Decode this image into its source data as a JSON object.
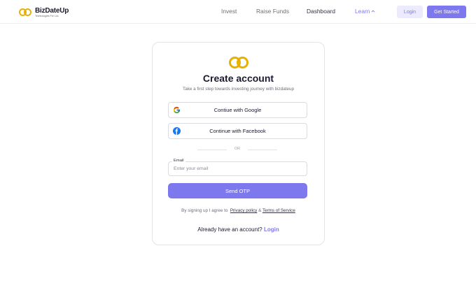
{
  "nav": {
    "logo_name": "BizDateUp",
    "logo_sub": "Technologies Pvt. Ltd.",
    "links": [
      "Invest",
      "Raise Funds",
      "Dashboard",
      "Learn"
    ],
    "login_label": "Login",
    "get_started_label": "Get Started"
  },
  "card": {
    "title": "Create account",
    "subtitle": "Take a first step towards investing journey with bizdateup",
    "google_label": "Contiue with Google",
    "facebook_label": "Continue with Facebook",
    "divider_text": "OR",
    "email_label": "Email",
    "email_placeholder": "Enter your email",
    "email_value": "",
    "send_otp_label": "Send OTP",
    "terms_prefix": "By signing up I agree to",
    "privacy_label": "Privacy policy",
    "terms_amp": "&",
    "terms_of_service_label": "Terms of Service",
    "have_account_text": "Already have an account?",
    "login_link_label": "Login"
  },
  "colors": {
    "accent": "#7e78ee",
    "accent_light": "#ecebfd",
    "brand_gold": "#e8b100"
  },
  "icons": {
    "logo": "double-ring-logo-icon",
    "google": "google-icon",
    "facebook": "facebook-icon",
    "learn_chevron": "chevron-up-icon"
  }
}
